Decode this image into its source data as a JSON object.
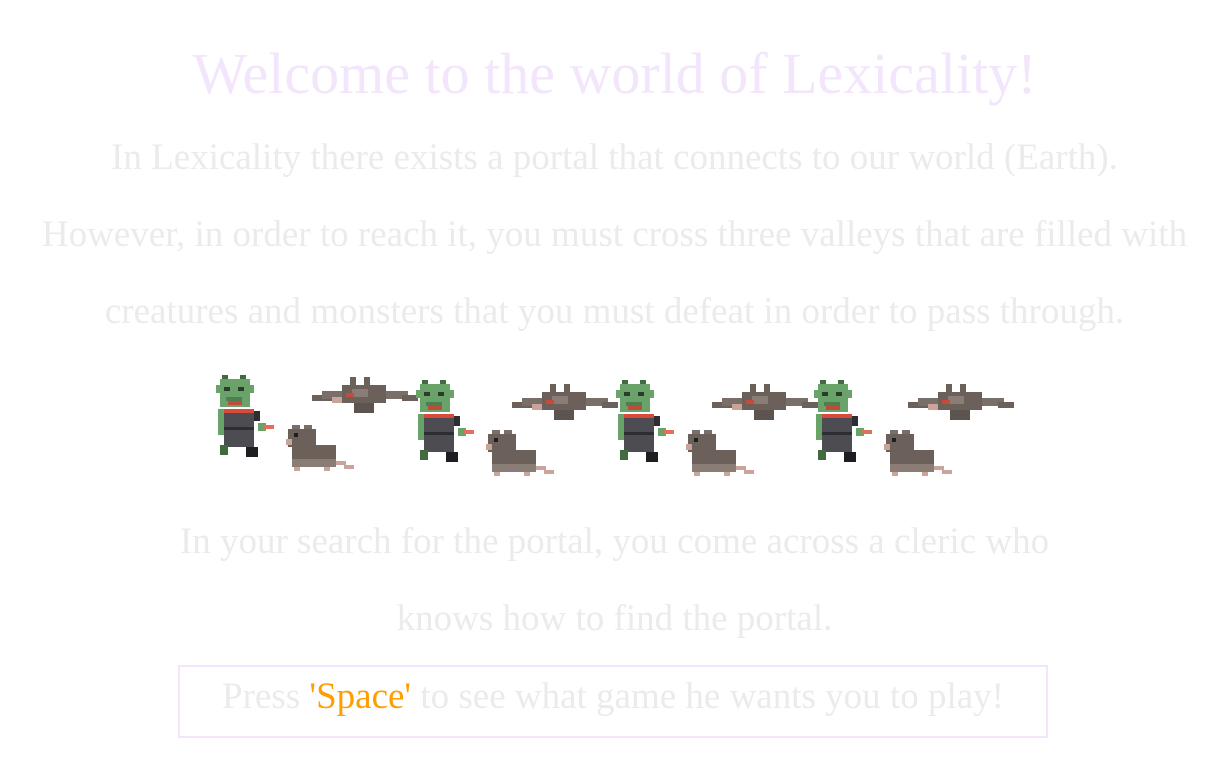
{
  "title": "Welcome to the world of Lexicality!",
  "intro": {
    "line1": "In Lexicality there exists a portal that connects to our world (Earth).",
    "line2": "However, in order to reach it, you must cross three valleys that are filled with",
    "line3": "creatures and monsters that you must defeat in order to pass through."
  },
  "sprites": {
    "groups": 4,
    "icons": [
      "goblin-sprite-icon",
      "rat-sprite-icon",
      "bat-sprite-icon"
    ]
  },
  "story": {
    "line1": "In your search for the portal, you come across a cleric who",
    "line2": "knows how to find the portal."
  },
  "prompt": {
    "before": "Press ",
    "key": "'Space'",
    "after": " to see what game he wants you to play!"
  },
  "colors": {
    "title": "#f3e6fc",
    "text": "#ebebeb",
    "key_highlight": "#ff9e00",
    "box_border": "#f3e6fc"
  }
}
